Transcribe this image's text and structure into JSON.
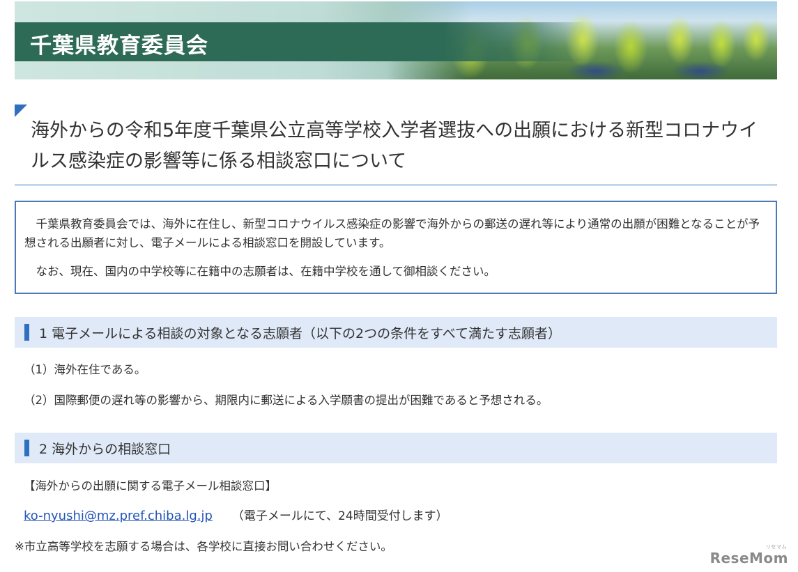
{
  "header": {
    "site_title": "千葉県教育委員会"
  },
  "page_title": "海外からの令和5年度千葉県公立高等学校入学者選抜への出願における新型コロナウイルス感染症の影響等に係る相談窓口について",
  "notice": {
    "p1": "千葉県教育委員会では、海外に在住し、新型コロナウイルス感染症の影響で海外からの郵送の遅れ等により通常の出願が困難となることが予想される出願者に対し、電子メールによる相談窓口を開設しています。",
    "p2": "なお、現在、国内の中学校等に在籍中の志願者は、在籍中学校を通して御相談ください。"
  },
  "section1": {
    "heading": "1 電子メールによる相談の対象となる志願者（以下の2つの条件をすべて満たす志願者）",
    "items": [
      "（1）海外在住である。",
      "（2）国際郵便の遅れ等の影響から、期限内に郵送による入学願書の提出が困難であると予想される。"
    ]
  },
  "section2": {
    "heading": "2 海外からの相談窓口",
    "label": "【海外からの出願に関する電子メール相談窓口】",
    "email": "ko-nyushi@mz.pref.chiba.lg.jp",
    "email_note": "（電子メールにて、24時間受付します）",
    "footnote": "※市立高等学校を志願する場合は、各学校に直接お問い合わせください。"
  },
  "brand": {
    "name": "ReseMom",
    "kana": "リセマム"
  },
  "colors": {
    "accent": "#2f6fc0",
    "section_bg": "#dfe9f7",
    "banner_band": "#2e6b56",
    "link": "#2455b8"
  }
}
